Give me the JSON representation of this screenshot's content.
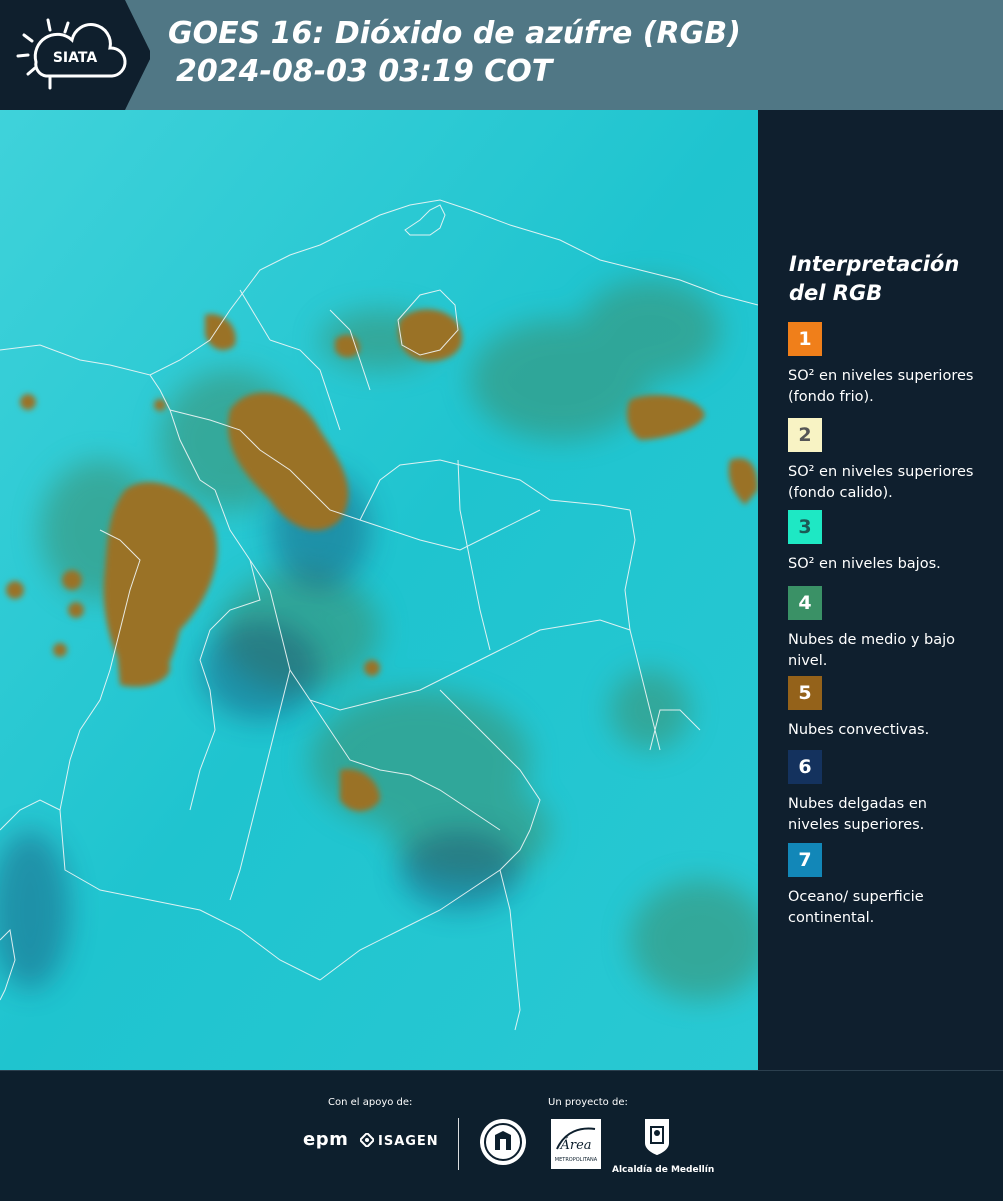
{
  "header": {
    "logo_text": "SIATA",
    "title": "GOES 16: Dióxido de azúfre (RGB)",
    "subtitle": "2024-08-03 03:19 COT"
  },
  "legend": {
    "title": "Interpretación del RGB",
    "items": [
      {
        "number": "1",
        "color": "#f07f1a",
        "text": "SO² en niveles superiores (fondo frio)."
      },
      {
        "number": "2",
        "color": "#f8f3c4",
        "text": "SO² en niveles superiores (fondo calido)."
      },
      {
        "number": "3",
        "color": "#1ee8c4",
        "text": "SO² en niveles bajos."
      },
      {
        "number": "4",
        "color": "#3a9166",
        "text": "Nubes de medio y bajo nivel."
      },
      {
        "number": "5",
        "color": "#94621a",
        "text": "Nubes convectivas."
      },
      {
        "number": "6",
        "color": "#14325e",
        "text": "Nubes delgadas en niveles superiores."
      },
      {
        "number": "7",
        "color": "#1287b8",
        "text": "Oceano/ superficie continental."
      }
    ]
  },
  "footer": {
    "support_label": "Con el apoyo de:",
    "project_label": "Un proyecto de:",
    "sponsor_1": "epm",
    "sponsor_2": "ISAGEN",
    "partner_area": "Área",
    "partner_area_sub": "METROPOLITANA",
    "partner_alcaldia": "Alcaldía de Medellín"
  },
  "colors": {
    "header_bg": "#507785",
    "panel_bg": "#0f1f2d",
    "map_base": "#22c8d2"
  }
}
